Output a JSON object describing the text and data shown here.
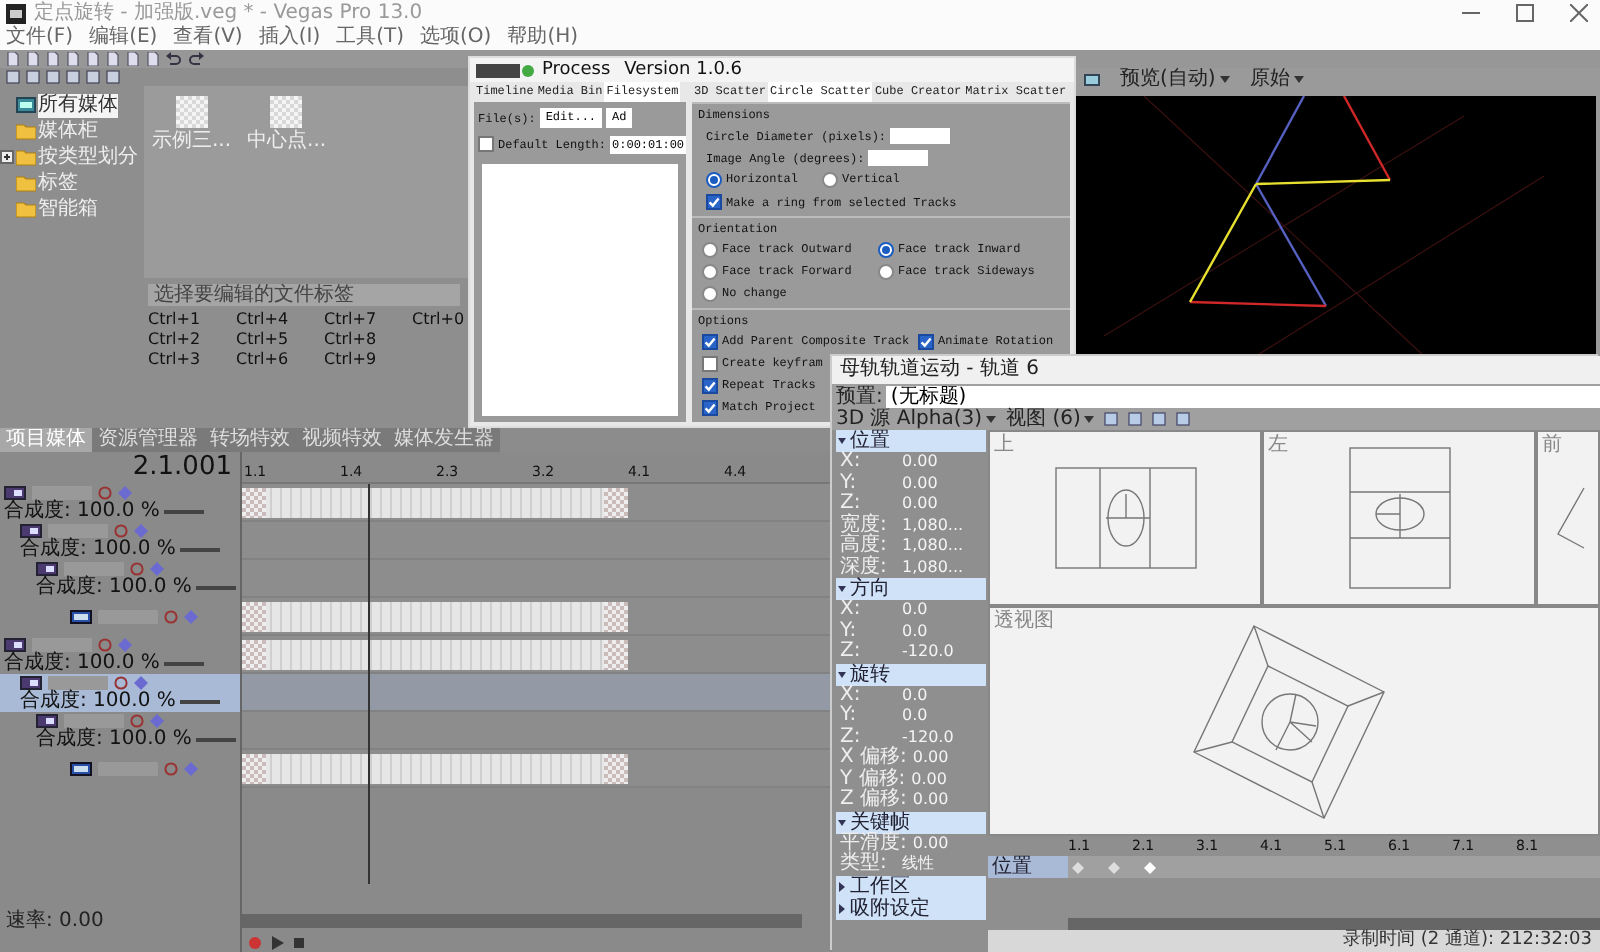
{
  "window": {
    "title": "定点旋转 - 加强版.veg * - Vegas Pro 13.0"
  },
  "menu": [
    "文件(F)",
    "编辑(E)",
    "查看(V)",
    "插入(I)",
    "工具(T)",
    "选项(O)",
    "帮助(H)"
  ],
  "media_tree": [
    {
      "label": "所有媒体",
      "kind": "all_media",
      "selected": true,
      "expandable": false
    },
    {
      "label": "媒体柜",
      "kind": "folder",
      "selected": false,
      "expandable": false
    },
    {
      "label": "按类型划分",
      "kind": "folder",
      "selected": false,
      "expandable": true
    },
    {
      "label": "标签",
      "kind": "folder",
      "selected": false,
      "expandable": false
    },
    {
      "label": "智能箱",
      "kind": "folder",
      "selected": false,
      "expandable": false
    }
  ],
  "media_items": [
    {
      "label": "示例三..."
    },
    {
      "label": "中心点..."
    }
  ],
  "tag_search": {
    "placeholder": "选择要编辑的文件标签"
  },
  "shortcuts": [
    "Ctrl+1",
    "Ctrl+2",
    "Ctrl+3",
    "Ctrl+4",
    "Ctrl+5",
    "Ctrl+6",
    "Ctrl+7",
    "Ctrl+8",
    "Ctrl+9",
    "Ctrl+0"
  ],
  "dock_tabs": [
    {
      "label": "项目媒体",
      "selected": true
    },
    {
      "label": "资源管理器",
      "selected": false
    },
    {
      "label": "转场特效",
      "selected": false
    },
    {
      "label": "视频特效",
      "selected": false
    },
    {
      "label": "媒体发生器",
      "selected": false
    }
  ],
  "preview": {
    "quality": "预览(自动)",
    "size": "原始"
  },
  "timeline": {
    "timecode": "2.1.001",
    "ruler": [
      "1.1",
      "1.4",
      "2.3",
      "3.2",
      "4.1",
      "4.4"
    ],
    "tracks": [
      {
        "kind": "composite",
        "opacity": "合成度: 100.0 %",
        "selected": false,
        "event": true,
        "children": [
          {
            "kind": "composite",
            "opacity": "合成度: 100.0 %",
            "selected": false,
            "event": false,
            "children": [
              {
                "kind": "composite",
                "opacity": "合成度: 100.0 %",
                "selected": false,
                "event": false,
                "children": [
                  {
                    "kind": "video",
                    "selected": false,
                    "event": true
                  }
                ]
              }
            ]
          }
        ]
      },
      {
        "kind": "composite",
        "opacity": "合成度: 100.0 %",
        "selected": false,
        "event": true,
        "children": [
          {
            "kind": "composite",
            "opacity": "合成度: 100.0 %",
            "selected": true,
            "event": false,
            "children": [
              {
                "kind": "composite",
                "opacity": "合成度: 100.0 %",
                "selected": false,
                "event": false,
                "children": [
                  {
                    "kind": "video",
                    "selected": false,
                    "event": true
                  }
                ]
              }
            ]
          }
        ]
      }
    ],
    "rate": "速率: 0.00"
  },
  "process": {
    "title": "Process",
    "version": "Version 1.0.6",
    "source_tabs": [
      {
        "label": "Timeline",
        "selected": false
      },
      {
        "label": "Media Bin",
        "selected": false
      },
      {
        "label": "Filesystem",
        "selected": true
      }
    ],
    "files_label": "File(s):",
    "buttons": [
      "Edit...",
      "Ad"
    ],
    "default_length": {
      "label": "Default Length:",
      "checked": false,
      "value": "0:00:01:00"
    },
    "tool_tabs": [
      {
        "label": "3D Scatter",
        "selected": false
      },
      {
        "label": "Circle Scatter",
        "selected": true
      },
      {
        "label": "Cube Creator",
        "selected": false
      },
      {
        "label": "Matrix Scatter",
        "selected": false
      }
    ],
    "dimensions": {
      "title": "Dimensions",
      "fields": [
        "Circle Diameter (pixels):",
        "Image Angle (degrees):"
      ],
      "radios": [
        {
          "label": "Horizontal",
          "selected": true
        },
        {
          "label": "Vertical",
          "selected": false
        }
      ],
      "ring": {
        "label": "Make a ring from selected Tracks",
        "checked": true
      }
    },
    "orientation": {
      "title": "Orientation",
      "radios": [
        {
          "label": "Face track Outward",
          "selected": false
        },
        {
          "label": "Face track Inward",
          "selected": true
        },
        {
          "label": "Face track Forward",
          "selected": false
        },
        {
          "label": "Face track Sideways",
          "selected": false
        },
        {
          "label": "No change",
          "selected": false
        }
      ]
    },
    "options": {
      "title": "Options",
      "checkboxes": [
        {
          "label": "Add Parent Composite Track",
          "checked": true
        },
        {
          "label": "Animate Rotation",
          "checked": true
        },
        {
          "label": "Create keyfram",
          "checked": false
        },
        {
          "label": "Repeat Tracks",
          "checked": true
        },
        {
          "label": "Match Project",
          "checked": true
        }
      ]
    }
  },
  "track_motion": {
    "title": "母轨轨道运动 - 轨道 6",
    "preset_label": "预置:",
    "preset_value": "(无标题)",
    "source": "3D 源 Alpha(3)",
    "view": "视图 (6)",
    "sections": [
      {
        "title": "位置",
        "expanded": true,
        "rows": [
          {
            "label": "X:",
            "value": "0.00"
          },
          {
            "label": "Y:",
            "value": "0.00"
          },
          {
            "label": "Z:",
            "value": "0.00"
          },
          {
            "label": "宽度:",
            "value": "1,080..."
          },
          {
            "label": "高度:",
            "value": "1,080..."
          },
          {
            "label": "深度:",
            "value": "1,080..."
          }
        ]
      },
      {
        "title": "方向",
        "expanded": true,
        "rows": [
          {
            "label": "X:",
            "value": "0.0"
          },
          {
            "label": "Y:",
            "value": "0.0"
          },
          {
            "label": "Z:",
            "value": "-120.0"
          }
        ]
      },
      {
        "title": "旋转",
        "expanded": true,
        "rows": [
          {
            "label": "X:",
            "value": "0.0"
          },
          {
            "label": "Y:",
            "value": "0.0"
          },
          {
            "label": "Z:",
            "value": "-120.0"
          },
          {
            "label": "X 偏移:",
            "value": "0.00"
          },
          {
            "label": "Y 偏移:",
            "value": "0.00"
          },
          {
            "label": "Z 偏移:",
            "value": "0.00"
          }
        ]
      },
      {
        "title": "关键帧",
        "expanded": true,
        "rows": [
          {
            "label": "平滑度:",
            "value": "0.00"
          },
          {
            "label": "类型:",
            "value": "线性"
          }
        ]
      },
      {
        "title": "工作区",
        "expanded": false
      },
      {
        "title": "吸附设定",
        "expanded": false
      }
    ],
    "viewports": [
      "上",
      "左",
      "前",
      "透视图"
    ],
    "keyframes": {
      "ruler": [
        "1.1",
        "2.1",
        "3.1",
        "4.1",
        "5.1",
        "6.1",
        "7.1",
        "8.1"
      ],
      "tracks": [
        {
          "label": "位置",
          "selected": true
        }
      ]
    },
    "status": "录制时间 (2 通道): 212:32:03"
  }
}
